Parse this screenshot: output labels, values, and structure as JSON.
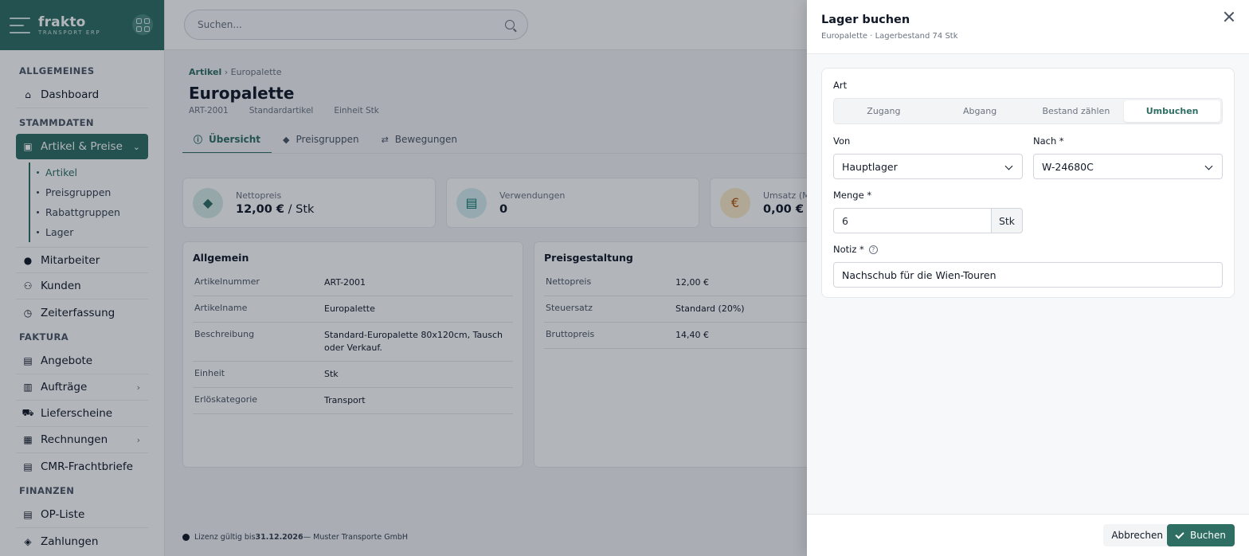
{
  "brand": {
    "name": "frakto",
    "sub": "TRANSPORT ERP"
  },
  "search": {
    "placeholder": "Suchen..."
  },
  "sidebar": {
    "sections": {
      "general": "ALLGEMEINES",
      "master": "STAMMDATEN",
      "billing": "FAKTURA",
      "finance": "FINANZEN"
    },
    "items": {
      "dashboard": "Dashboard",
      "articles": "Artikel & Preise",
      "employees": "Mitarbeiter",
      "customers": "Kunden",
      "timetracking": "Zeiterfassung",
      "quotes": "Angebote",
      "orders": "Aufträge",
      "delivery": "Lieferscheine",
      "invoices": "Rechnungen",
      "cmr": "CMR-Frachtbriefe",
      "oplist": "OP-Liste",
      "payments": "Zahlungen"
    },
    "sub_items": [
      "Artikel",
      "Preisgruppen",
      "Rabattgruppen",
      "Lager"
    ]
  },
  "breadcrumb": {
    "root": "Artikel",
    "sep": "›",
    "current": "Europalette"
  },
  "page": {
    "title": "Europalette",
    "meta": [
      "ART-2001",
      "Standardartikel",
      "Einheit Stk"
    ],
    "tabs": [
      "Übersicht",
      "Preisgruppen",
      "Bewegungen"
    ]
  },
  "stats": [
    {
      "label": "Nettopreis",
      "value": "12,00 €",
      "unit": " / Stk"
    },
    {
      "label": "Verwendungen",
      "value": "0",
      "unit": ""
    },
    {
      "label": "Umsatz (M",
      "value": "0,00 €",
      "unit": ""
    }
  ],
  "general_card": {
    "title": "Allgemein",
    "rows": [
      {
        "k": "Artikelnummer",
        "v": "ART-2001"
      },
      {
        "k": "Artikelname",
        "v": "Europalette"
      },
      {
        "k": "Beschreibung",
        "v": "Standard-Europalette 80x120cm, Tausch oder Verkauf."
      },
      {
        "k": "Einheit",
        "v": "Stk"
      },
      {
        "k": "Erlöskategorie",
        "v": "Transport"
      }
    ]
  },
  "pricing_card": {
    "title": "Preisgestaltung",
    "rows": [
      {
        "k": "Nettopreis",
        "v": "12,00 €"
      },
      {
        "k": "Steuersatz",
        "v": "Standard (20%)"
      },
      {
        "k": "Bruttopreis",
        "v": "14,40 €"
      }
    ]
  },
  "footer": {
    "prefix": "Lizenz gültig bis ",
    "date": "31.12.2026",
    "suffix": " — Muster Transporte GmbH"
  },
  "drawer": {
    "title": "Lager buchen",
    "subtitle": "Europalette · Lagerbestand 74 Stk",
    "art_label": "Art",
    "segments": [
      "Zugang",
      "Abgang",
      "Bestand zählen",
      "Umbuchen"
    ],
    "from_label": "Von",
    "from_value": "Hauptlager",
    "to_label": "Nach *",
    "to_value": "W-24680C",
    "qty_label": "Menge *",
    "qty_value": "6",
    "qty_unit": "Stk",
    "note_label": "Notiz *",
    "note_help": "?",
    "note_value": "Nachschub für die Wien-Touren",
    "cancel": "Abbrechen",
    "submit": "Buchen"
  },
  "colors": {
    "accent": "#2e6e63"
  }
}
